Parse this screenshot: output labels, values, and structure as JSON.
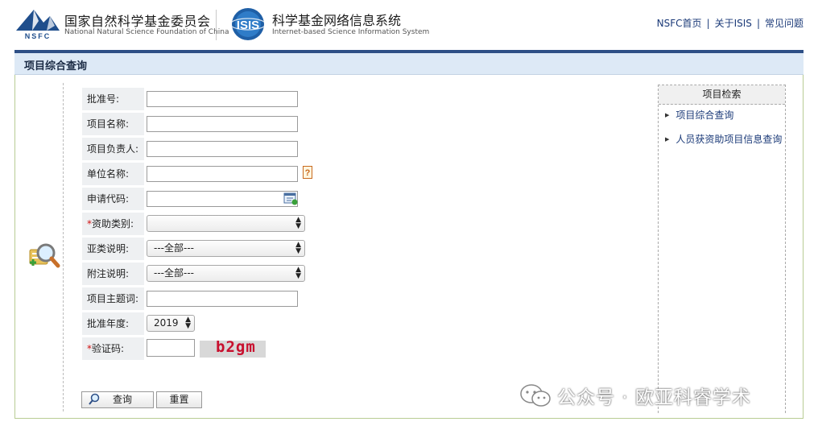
{
  "header": {
    "nsfc_logo_text": "NSFC",
    "nsfc_name_cn": "国家自然科学基金委员会",
    "nsfc_name_en": "National Natural Science Foundation of China",
    "isis_logo_text": "ISIS",
    "isis_name_cn": "科学基金网络信息系统",
    "isis_name_en": "Internet-based Science Information System",
    "links": [
      "NSFC首页",
      "关于ISIS",
      "常见问题"
    ]
  },
  "page_title": "项目综合查询",
  "form": {
    "approval_no_label": "批准号:",
    "project_name_label": "项目名称:",
    "pi_label": "项目负责人:",
    "org_label": "单位名称:",
    "apply_code_label": "申请代码:",
    "funding_type_label": "资助类别:",
    "subtype_label": "亚类说明:",
    "subtype_value": "---全部---",
    "note_label": "附注说明:",
    "note_value": "---全部---",
    "keyword_label": "项目主题词:",
    "year_label": "批准年度:",
    "year_value": "2019",
    "captcha_label": "验证码:",
    "captcha_text": "b2gm",
    "required_mark": "*"
  },
  "buttons": {
    "query": "查询",
    "reset": "重置"
  },
  "sidebar": {
    "title": "项目检索",
    "items": [
      "项目综合查询",
      "人员获资助项目信息查询"
    ]
  },
  "watermark": "公众号 · 欧亚科睿学术",
  "colors": {
    "accent_blue": "#2d4f86",
    "link_blue": "#1b3a78",
    "panel_border": "#b8cc93",
    "captcha_red": "#c8102e"
  }
}
